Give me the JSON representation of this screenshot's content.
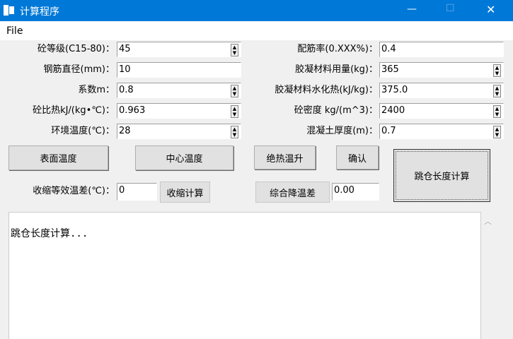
{
  "window": {
    "title": "计算程序",
    "minimize": "—",
    "maximize": "☐",
    "close": "✕"
  },
  "menu": {
    "file": "File"
  },
  "left_fields": [
    {
      "label": "砼等级(C15-80)：",
      "value": "45",
      "spinner": true
    },
    {
      "label": "钢筋直径(mm)：",
      "value": "10",
      "spinner": false
    },
    {
      "label": "系数m：",
      "value": "0.8",
      "spinner": true
    },
    {
      "label": "砼比热kJ/(kg•℃)：",
      "value": "0.963",
      "spinner": true
    },
    {
      "label": "环境温度(℃)：",
      "value": "28",
      "spinner": true
    }
  ],
  "right_fields": [
    {
      "label": "配筋率(0.XXX%)：",
      "value": "0.4",
      "spinner": false
    },
    {
      "label": "胶凝材料用量(kg)：",
      "value": "365",
      "spinner": true
    },
    {
      "label": "胶凝材料水化热(kJ/kg)：",
      "value": "375.0",
      "spinner": true
    },
    {
      "label": "砼密度 kg/(m^3)：",
      "value": "2400",
      "spinner": true
    },
    {
      "label": "混凝土厚度(m)：",
      "value": "0.7",
      "spinner": true
    }
  ],
  "buttons": {
    "surface_temp": "表面温度",
    "center_temp": "中心温度",
    "adiabatic": "绝热温升",
    "confirm": "确认",
    "jump_length": "跳仓长度计算",
    "shrink_calc": "收缩计算",
    "combined_drop": "综合降温差"
  },
  "shrink": {
    "label": "收缩等效温差(℃)：",
    "value": "0"
  },
  "combined": {
    "value": "0.00"
  },
  "output": {
    "text": "跳仓长度计算..."
  }
}
